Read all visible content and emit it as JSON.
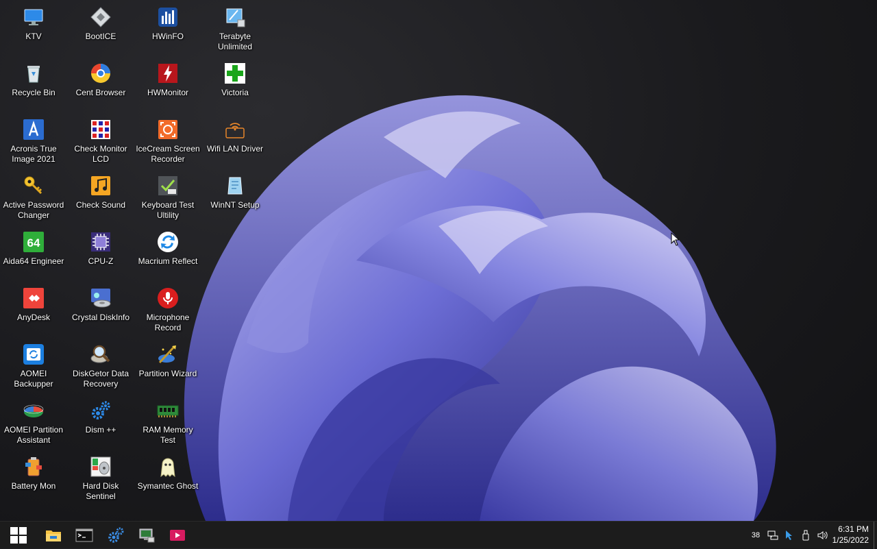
{
  "desktop": {
    "icons": [
      {
        "label": "KTV",
        "icon": "monitor-icon"
      },
      {
        "label": "Recycle Bin",
        "icon": "recycle-bin-icon"
      },
      {
        "label": "Acronis True Image 2021",
        "icon": "acronis-icon"
      },
      {
        "label": "Active Password Changer",
        "icon": "key-icon"
      },
      {
        "label": "Aida64 Engineer",
        "icon": "aida64-icon"
      },
      {
        "label": "AnyDesk",
        "icon": "anydesk-icon"
      },
      {
        "label": "AOMEI Backupper",
        "icon": "aomei-backupper-icon"
      },
      {
        "label": "AOMEI Partition Assistant",
        "icon": "aomei-partition-icon"
      },
      {
        "label": "Battery Mon",
        "icon": "battery-mon-icon"
      },
      {
        "label": "BootICE",
        "icon": "bootice-icon"
      },
      {
        "label": "Cent Browser",
        "icon": "cent-browser-icon"
      },
      {
        "label": "Check Monitor LCD",
        "icon": "check-monitor-icon"
      },
      {
        "label": "Check Sound",
        "icon": "music-note-icon"
      },
      {
        "label": "CPU-Z",
        "icon": "cpu-icon"
      },
      {
        "label": "Crystal DiskInfo",
        "icon": "disk-info-icon"
      },
      {
        "label": "DiskGetor Data Recovery",
        "icon": "magnifier-disk-icon"
      },
      {
        "label": "Dism ++",
        "icon": "gears-icon"
      },
      {
        "label": "Hard Disk Sentinel",
        "icon": "hard-disk-icon"
      },
      {
        "label": "HWinFO",
        "icon": "hwinfo-icon"
      },
      {
        "label": "HWMonitor",
        "icon": "hwmonitor-icon"
      },
      {
        "label": "IceCream Screen Recorder",
        "icon": "screen-recorder-icon"
      },
      {
        "label": "Keyboard Test Ultility",
        "icon": "keyboard-test-icon"
      },
      {
        "label": "Macrium Reflect",
        "icon": "macrium-icon"
      },
      {
        "label": "Microphone Record",
        "icon": "microphone-icon"
      },
      {
        "label": "Partition Wizard",
        "icon": "partition-wizard-icon"
      },
      {
        "label": "RAM Memory Test",
        "icon": "ram-icon"
      },
      {
        "label": "Symantec Ghost",
        "icon": "ghost-icon"
      },
      {
        "label": "Terabyte Unlimited",
        "icon": "terabyte-icon"
      },
      {
        "label": "Victoria",
        "icon": "cross-icon"
      },
      {
        "label": "Wifi LAN Driver",
        "icon": "wifi-icon"
      },
      {
        "label": "WinNT Setup",
        "icon": "winnt-setup-icon"
      }
    ]
  },
  "taskbar": {
    "buttons": [
      {
        "name": "start-button",
        "icon": "windows-logo-icon"
      },
      {
        "name": "file-explorer-button",
        "icon": "folder-icon"
      },
      {
        "name": "command-prompt-button",
        "icon": "terminal-icon"
      },
      {
        "name": "pinned-app-button",
        "icon": "gears-icon"
      },
      {
        "name": "remote-app-button",
        "icon": "monitor-tools-icon"
      },
      {
        "name": "media-app-button",
        "icon": "media-icon"
      }
    ],
    "tray": {
      "count": "38",
      "icons": [
        "network-icon",
        "pointer-icon",
        "usb-icon",
        "speaker-icon"
      ]
    },
    "clock": {
      "time": "6:31 PM",
      "date": "1/25/2022"
    }
  },
  "colors": {
    "taskbar": "#1c1c1c",
    "wallpaper_petal": "#5e5fd0",
    "accent": "#0078d4"
  }
}
